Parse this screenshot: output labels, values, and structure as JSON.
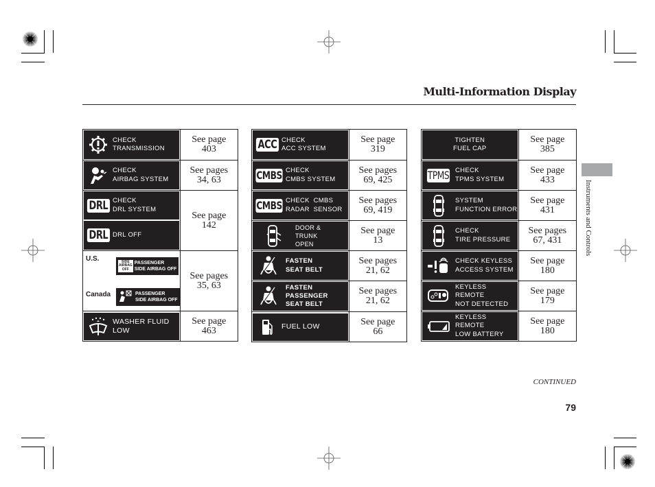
{
  "header": {
    "title": "Multi-Information Display"
  },
  "side_tab": {
    "label": "Instruments and Controls",
    "color": "#a7a9ac"
  },
  "footer": {
    "continued": "CONTINUED",
    "page_number": "79"
  },
  "tables": [
    {
      "rows": [
        {
          "messages": [
            {
              "icon": "transmission-gear-warning-icon",
              "text": "CHECK\nTRANSMISSION"
            }
          ],
          "ref": "See page\n403"
        },
        {
          "messages": [
            {
              "icon": "airbag-icon",
              "text": "CHECK\nAIRBAG SYSTEM"
            }
          ],
          "ref": "See pages\n34, 63"
        },
        {
          "messages": [
            {
              "icon": "drl-icon",
              "badge": "DRL",
              "text": "CHECK\nDRL SYSTEM"
            },
            {
              "icon": "drl-icon",
              "badge": "DRL",
              "text": "DRL OFF"
            }
          ],
          "ref": "See page\n142"
        },
        {
          "messages": [
            {
              "region": "U.S.",
              "icon": "side-airbag-off-icon",
              "badge_text": "SIDE\nAIRBAG\nOFF",
              "text": "PASSENGER\nSIDE AIRBAG OFF"
            },
            {
              "region": "Canada",
              "icon": "side-airbag-off-symbol-icon",
              "text": "PASSENGER\nSIDE AIRBAG OFF"
            }
          ],
          "ref": "See pages\n35, 63"
        },
        {
          "messages": [
            {
              "icon": "washer-fluid-icon",
              "text": "WASHER FLUID\nLOW"
            }
          ],
          "ref": "See page\n463"
        }
      ]
    },
    {
      "rows": [
        {
          "messages": [
            {
              "icon": "acc-icon",
              "badge": "ACC",
              "text": "CHECK\nACC SYSTEM"
            }
          ],
          "ref": "See page\n319"
        },
        {
          "messages": [
            {
              "icon": "cmbs-icon",
              "badge": "CMBS",
              "text": "CHECK\nCMBS SYSTEM"
            }
          ],
          "ref": "See pages\n69, 425"
        },
        {
          "messages": [
            {
              "icon": "cmbs-icon",
              "badge": "CMBS",
              "text": "CHECK  CMBS\nRADAR  SENSOR"
            }
          ],
          "ref": "See pages\n69, 419"
        },
        {
          "messages": [
            {
              "icon": "door-open-car-icon",
              "text": "DOOR &\nTRUNK\nOPEN"
            }
          ],
          "ref": "See page\n13"
        },
        {
          "messages": [
            {
              "icon": "seat-belt-icon",
              "text": "FASTEN\nSEAT BELT"
            }
          ],
          "ref": "See pages\n21, 62"
        },
        {
          "messages": [
            {
              "icon": "seat-belt-icon",
              "text": "FASTEN\nPASSENGER\nSEAT BELT"
            }
          ],
          "ref": "See pages\n21, 62"
        },
        {
          "messages": [
            {
              "icon": "fuel-pump-icon",
              "text": "FUEL LOW"
            }
          ],
          "ref": "See page\n66"
        }
      ]
    },
    {
      "rows": [
        {
          "messages": [
            {
              "icon": "",
              "text": "TIGHTEN\nFUEL CAP"
            }
          ],
          "ref": "See page\n385"
        },
        {
          "messages": [
            {
              "icon": "tpms-icon",
              "badge": "TPMS",
              "text": "CHECK\nTPMS SYSTEM"
            }
          ],
          "ref": "See page\n433"
        },
        {
          "messages": [
            {
              "icon": "car-top-view-icon",
              "text": "SYSTEM\nFUNCTION ERROR"
            }
          ],
          "ref": "See page\n431"
        },
        {
          "messages": [
            {
              "icon": "car-top-view-icon",
              "text": "CHECK\nTIRE PRESSURE"
            }
          ],
          "ref": "See pages\n67, 431"
        },
        {
          "messages": [
            {
              "icon": "keyless-access-icon",
              "text": "CHECK KEYLESS\nACCESS SYSTEM"
            }
          ],
          "ref": "See page\n180"
        },
        {
          "messages": [
            {
              "icon": "keyless-remote-icon",
              "text": "KEYLESS REMOTE\nNOT DETECTED"
            }
          ],
          "ref": "See page\n179"
        },
        {
          "messages": [
            {
              "icon": "low-battery-icon",
              "text": "KEYLESS REMOTE\nLOW BATTERY"
            }
          ],
          "ref": "See page\n180"
        }
      ]
    }
  ]
}
